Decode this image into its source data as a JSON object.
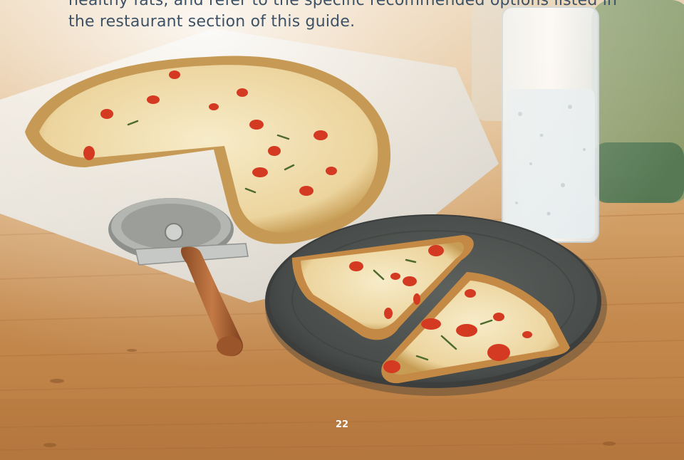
{
  "body_text": {
    "lines": [
      "healthy fats, and refer to the specific recommended options listed in",
      "the restaurant section of this guide."
    ]
  },
  "page_number": "22",
  "photo": {
    "subject": "pizza-photo",
    "colors": {
      "wood_table": "#c8955c",
      "baking_paper": "#ddd9d0",
      "plate": "#4a4e4c",
      "cheese": "#efdcaa",
      "crust": "#c49a55",
      "tomato": "#d43a22"
    }
  }
}
